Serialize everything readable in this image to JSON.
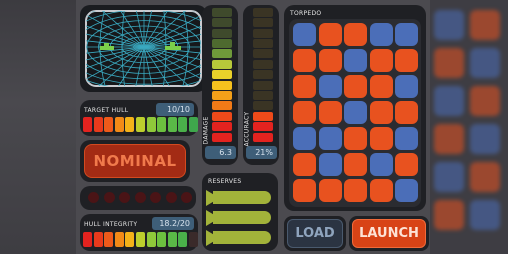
{
  "panels": {
    "target_hull_label": "TARGET HULL",
    "target_hull_value": "10/10",
    "status": "NOMINAL",
    "hull_integrity_label": "HULL INTEGRITY",
    "hull_integrity_value": "18.2/20",
    "damage_label": "DAMAGE",
    "damage_value": "6.3",
    "accuracy_label": "ACCURACY",
    "accuracy_value": "21%",
    "reserves_label": "RESERVES",
    "torpedo_label": "TORPEDO",
    "load_label": "LOAD",
    "launch_label": "LAUNCH"
  },
  "gauges": {
    "target_hull_fraction": 1.0,
    "hull_integrity_fraction": 0.91,
    "damage_lit_segments": 10,
    "accuracy_lit_segments": 3,
    "reserves_count": 3
  },
  "colors": {
    "orange": "#e8521f",
    "blue": "#4b6eb8",
    "accent_red": "#d84316",
    "torpedo_green": "#a2b33a",
    "sonar_teal": "#3aa9c0"
  },
  "torpedo_grid": [
    [
      "blue",
      "orange",
      "orange",
      "blue",
      "blue"
    ],
    [
      "orange",
      "orange",
      "blue",
      "orange",
      "orange"
    ],
    [
      "orange",
      "blue",
      "orange",
      "orange",
      "blue"
    ],
    [
      "orange",
      "orange",
      "blue",
      "orange",
      "orange"
    ],
    [
      "blue",
      "blue",
      "orange",
      "orange",
      "blue"
    ],
    [
      "orange",
      "blue",
      "orange",
      "blue",
      "orange"
    ],
    [
      "orange",
      "orange",
      "orange",
      "orange",
      "blue"
    ]
  ]
}
